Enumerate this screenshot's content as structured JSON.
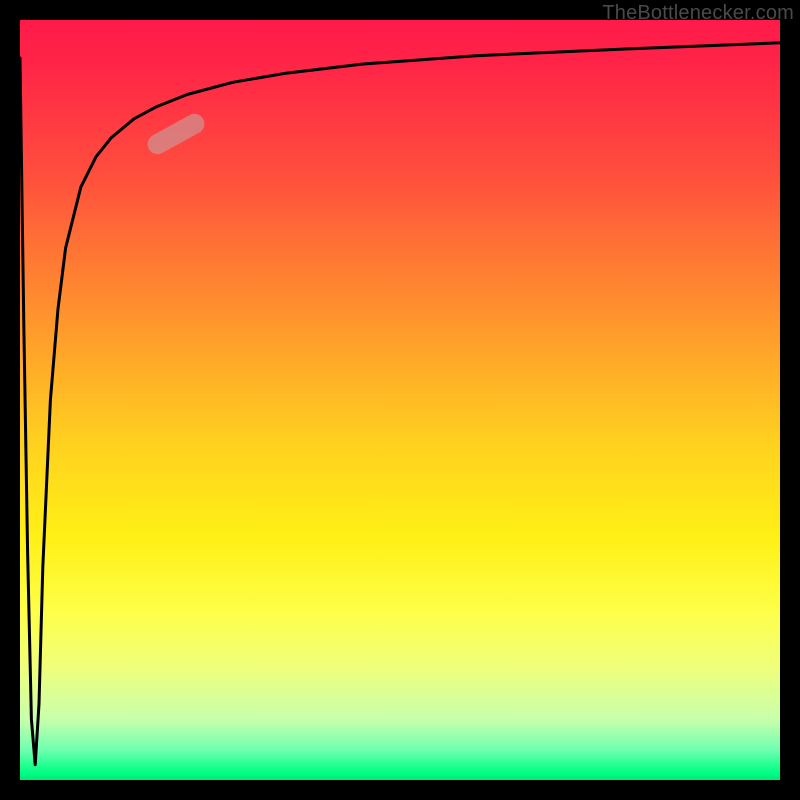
{
  "watermark": "TheBottlenecker.com",
  "colors": {
    "frame": "#000000",
    "curve": "#000000",
    "marker": "rgba(210,140,140,0.78)",
    "gradient_top": "#ff1a4a",
    "gradient_bottom": "#00e874"
  },
  "chart_data": {
    "type": "line",
    "title": "",
    "xlabel": "",
    "ylabel": "",
    "xlim": [
      0,
      100
    ],
    "ylim": [
      0,
      100
    ],
    "marker_start": {
      "x": 17,
      "y": 83
    },
    "marker_end": {
      "x": 24,
      "y": 87
    },
    "series": [
      {
        "name": "bottleneck-curve",
        "x": [
          0,
          0.5,
          1,
          1.5,
          2,
          2.5,
          3,
          4,
          5,
          6,
          8,
          10,
          12,
          15,
          18,
          22,
          28,
          35,
          45,
          60,
          80,
          100
        ],
        "y": [
          95,
          60,
          30,
          8,
          2,
          10,
          28,
          50,
          62,
          70,
          78,
          82,
          84.5,
          87,
          88.6,
          90.2,
          91.8,
          93,
          94.2,
          95.3,
          96.2,
          97
        ]
      }
    ]
  }
}
